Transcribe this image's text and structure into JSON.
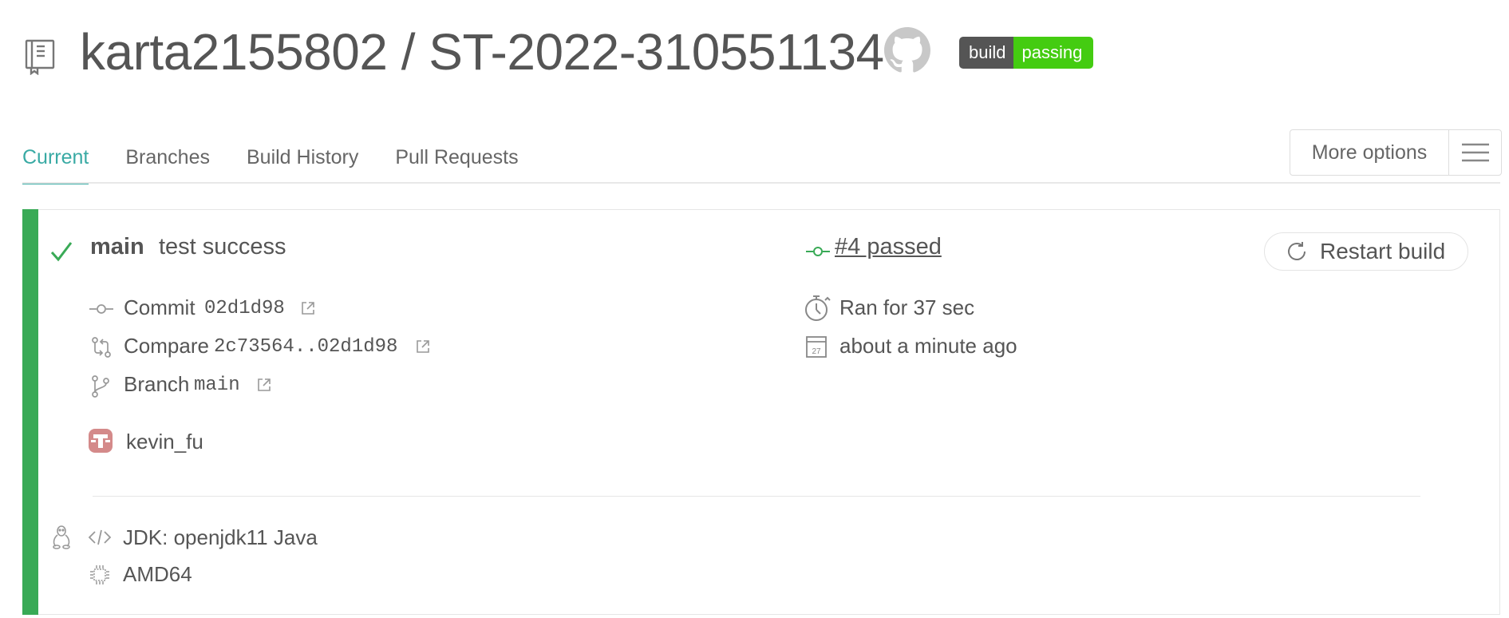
{
  "header": {
    "repo_title": "karta2155802 / ST-2022-310551134",
    "badge_left": "build",
    "badge_right": "passing",
    "badge_colors": {
      "left": "#555555",
      "right": "#44cc11"
    }
  },
  "tabs": [
    {
      "label": "Current",
      "active": true
    },
    {
      "label": "Branches",
      "active": false
    },
    {
      "label": "Build History",
      "active": false
    },
    {
      "label": "Pull Requests",
      "active": false
    }
  ],
  "more_options": {
    "label": "More options"
  },
  "build": {
    "branch": "main",
    "message": "test success",
    "number_status": "#4 passed",
    "restart_label": "Restart build",
    "commit_label": "Commit",
    "commit_sha": "02d1d98",
    "compare_label": "Compare",
    "compare_range": "2c73564..02d1d98",
    "branch_label": "Branch",
    "branch_name": "main",
    "duration": "Ran for 37 sec",
    "finished": "about a minute ago",
    "author": "kevin_fu",
    "jdk": "JDK: openjdk11 Java",
    "arch": "AMD64",
    "calendar_day": "27"
  },
  "colors": {
    "accent_teal": "#39aaa4",
    "success_green": "#39aa56",
    "text": "#555555"
  },
  "icons": [
    "repo-icon",
    "github-icon",
    "check-icon",
    "commit-icon",
    "external-link-icon",
    "compare-icon",
    "branch-icon",
    "stopwatch-icon",
    "calendar-icon",
    "restart-icon",
    "menu-icon",
    "linux-icon",
    "code-icon",
    "cpu-icon",
    "avatar"
  ]
}
